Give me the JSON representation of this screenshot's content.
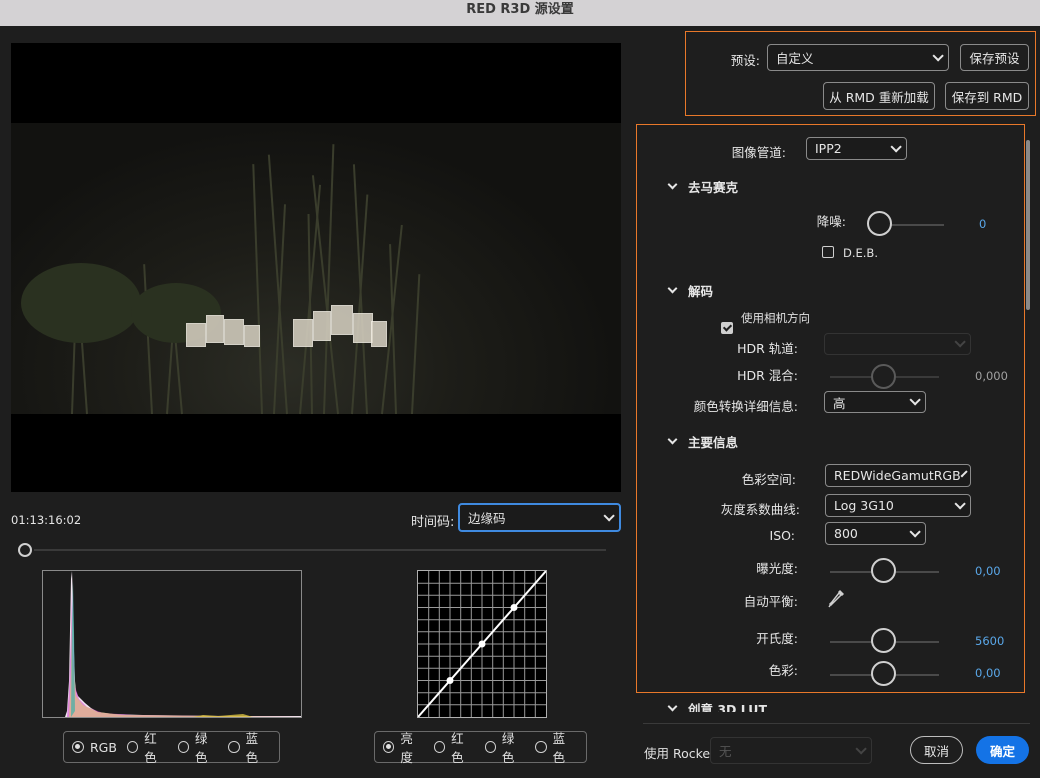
{
  "window": {
    "title": "RED R3D 源设置"
  },
  "preview": {
    "timecode": "01:13:16:02",
    "timecode_mode_label": "时间码:",
    "timecode_mode_value": "边缘码"
  },
  "histogram_channels": [
    {
      "label": "RGB",
      "selected": true
    },
    {
      "label": "红色",
      "selected": false
    },
    {
      "label": "绿色",
      "selected": false
    },
    {
      "label": "蓝色",
      "selected": false
    }
  ],
  "curve_channels": [
    {
      "label": "亮度",
      "selected": true
    },
    {
      "label": "红色",
      "selected": false
    },
    {
      "label": "绿色",
      "selected": false
    },
    {
      "label": "蓝色",
      "selected": false
    }
  ],
  "presets": {
    "label": "预设:",
    "value": "自定义",
    "save_preset": "保存预设",
    "reload_rmd": "从 RMD 重新加载",
    "save_rmd": "保存到 RMD"
  },
  "settings": {
    "pipeline_label": "图像管道:",
    "pipeline_value": "IPP2",
    "demosaic": {
      "title": "去马赛克",
      "noise_label": "降噪:",
      "noise_value": "0",
      "noise_level": 0,
      "deb_label": "D.E.B.",
      "deb_checked": false
    },
    "decode": {
      "title": "解码",
      "camera_orient_label": "使用相机方向",
      "camera_orient_checked": true,
      "hdr_track_label": "HDR 轨道:",
      "hdr_track_value": "",
      "hdr_blend_label": "HDR 混合:",
      "hdr_blend_value": "0,000",
      "detail_label": "颜色转换详细信息:",
      "detail_value": "高"
    },
    "primary": {
      "title": "主要信息",
      "colorspace_label": "色彩空间:",
      "colorspace_value": "REDWideGamutRGB",
      "gamma_label": "灰度系数曲线:",
      "gamma_value": "Log 3G10",
      "iso_label": "ISO:",
      "iso_value": "800",
      "exposure_label": "曝光度:",
      "exposure_value": "0,00",
      "awb_label": "自动平衡:",
      "kelvin_label": "开氏度:",
      "kelvin_value": "5600",
      "tint_label": "色彩:",
      "tint_value": "0,00"
    },
    "creative_lut": {
      "title": "创意 3D LUT"
    }
  },
  "footer": {
    "rocket_label": "使用 Rocket:",
    "rocket_value": "无",
    "cancel": "取消",
    "ok": "确定"
  },
  "colors": {
    "accent": "#1473e6",
    "highlight_box": "#e8782a",
    "value_blue": "#5aa7e8"
  }
}
